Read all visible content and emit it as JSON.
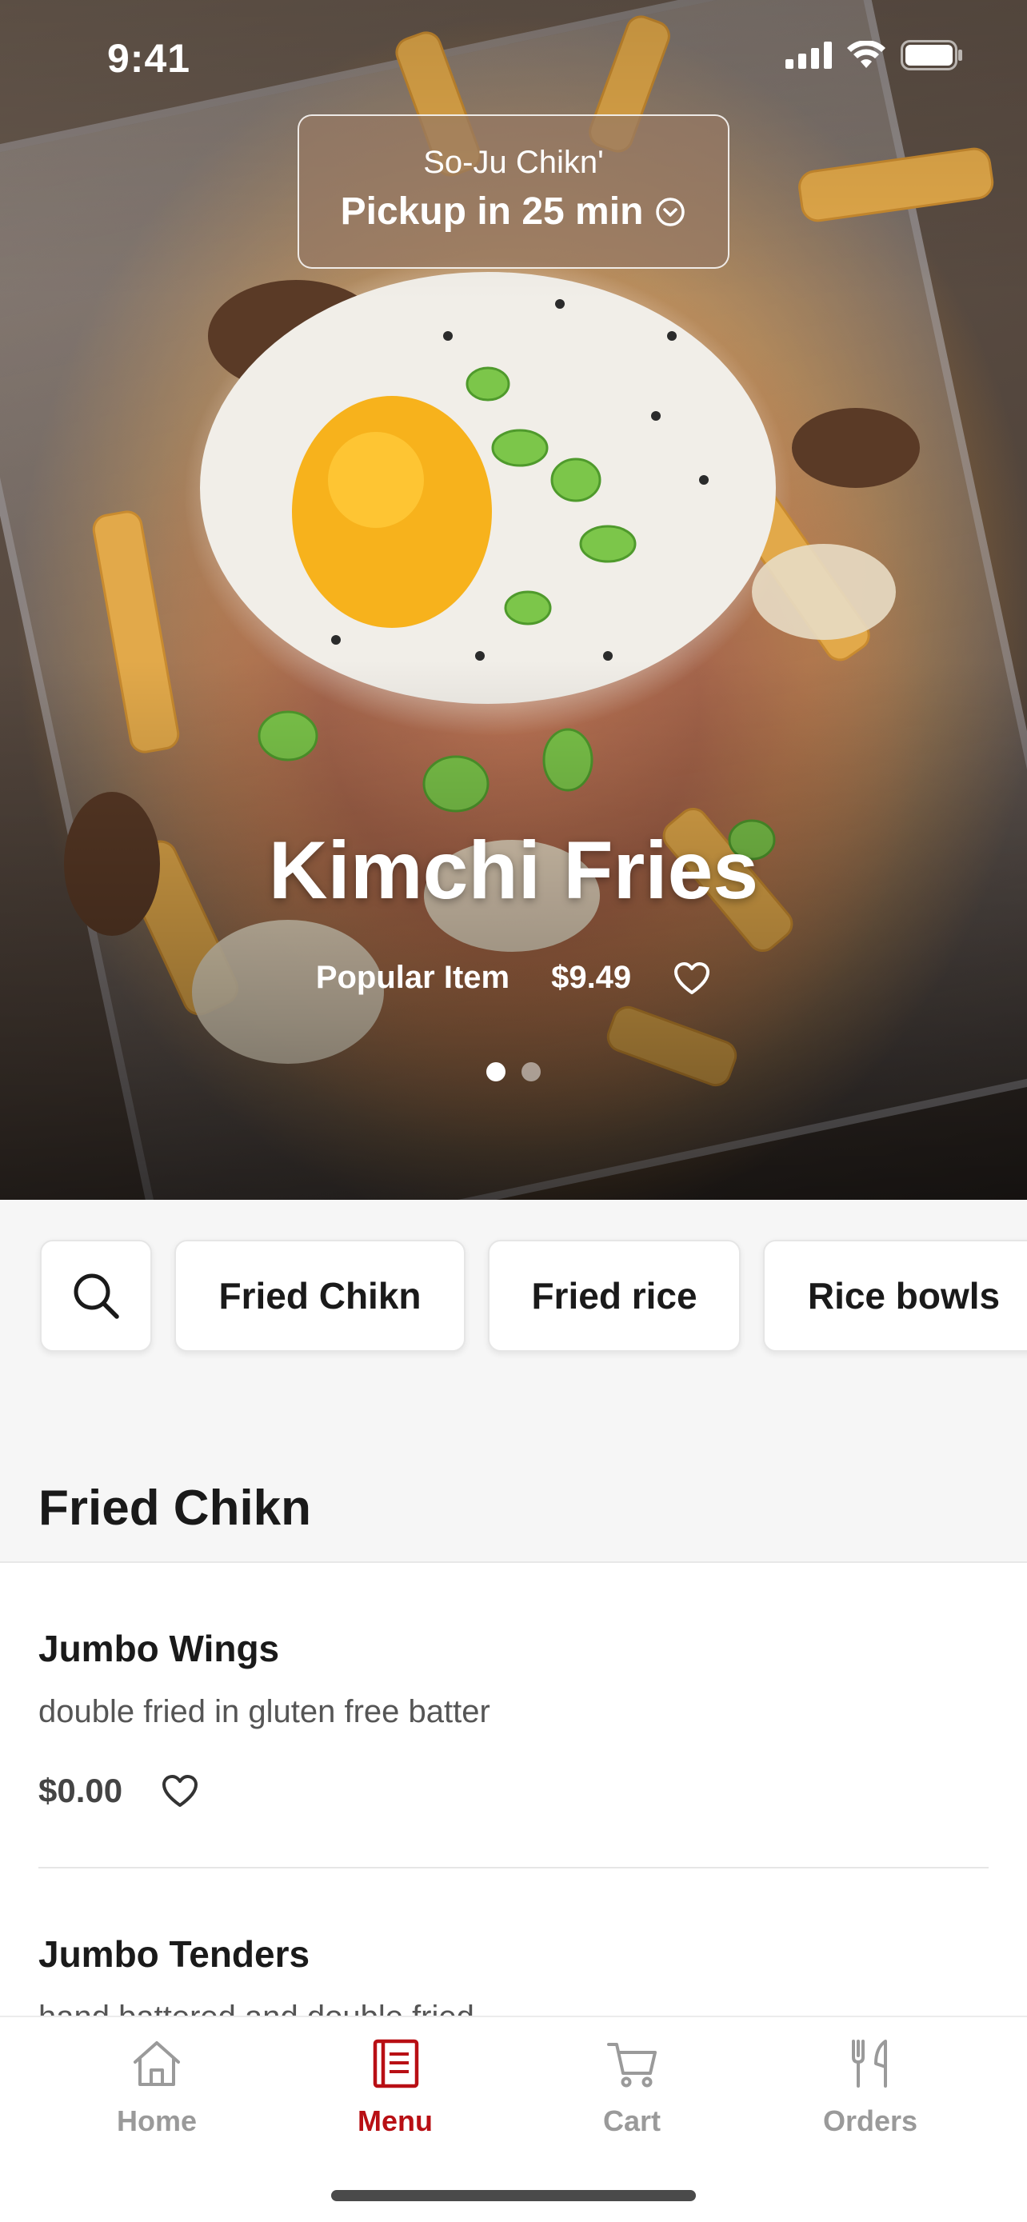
{
  "status_bar": {
    "time": "9:41"
  },
  "pickup": {
    "store_name": "So-Ju Chikn'",
    "pickup_text": "Pickup in 25 min"
  },
  "hero": {
    "title": "Kimchi Fries",
    "tag": "Popular Item",
    "price": "$9.49",
    "carousel": {
      "pages": 2,
      "active": 1
    }
  },
  "categories": [
    {
      "label": "Fried Chikn"
    },
    {
      "label": "Fried rice"
    },
    {
      "label": "Rice bowls"
    }
  ],
  "section": {
    "title": "Fried Chikn"
  },
  "items": [
    {
      "name": "Jumbo Wings",
      "description": "double fried in gluten free batter",
      "price": "$0.00"
    },
    {
      "name": "Jumbo Tenders",
      "description": "hand battered and double fried"
    }
  ],
  "tabs": [
    {
      "label": "Home",
      "icon": "home-icon"
    },
    {
      "label": "Menu",
      "icon": "menu-book-icon",
      "active": true
    },
    {
      "label": "Cart",
      "icon": "cart-icon"
    },
    {
      "label": "Orders",
      "icon": "fork-knife-icon"
    }
  ],
  "colors": {
    "accent": "#b80f14",
    "inactive_tab": "#9a9a9a"
  }
}
